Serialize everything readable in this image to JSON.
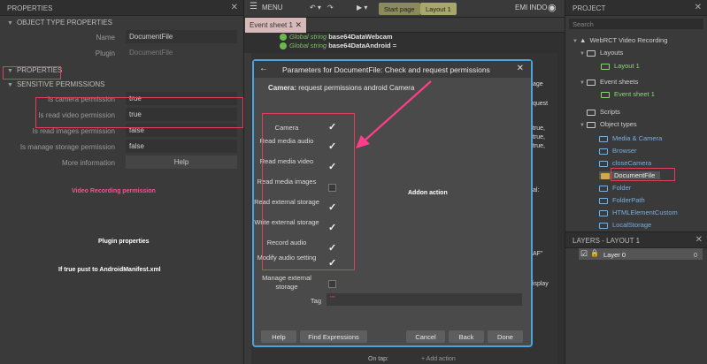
{
  "left": {
    "header": "PROPERTIES",
    "sections": {
      "object_type": "OBJECT TYPE PROPERTIES",
      "properties": "PROPERTIES",
      "sensitive": "SENSITIVE PERMISSIONS"
    },
    "name_label": "Name",
    "name_value": "DocumentFile",
    "plugin_label": "Plugin",
    "plugin_value": "DocumentFile",
    "perm_rows": [
      {
        "label": "Is camera permission",
        "value": "true"
      },
      {
        "label": "Is read video permission",
        "value": "true"
      },
      {
        "label": "Is read images permission",
        "value": "false"
      },
      {
        "label": "Is manage storage permission",
        "value": "false"
      }
    ],
    "more_info_label": "More information",
    "help_label": "Help",
    "notes": {
      "video": "Video Recording permission",
      "plugin": "Plugin properties",
      "manifest": "If true  pust to AndroidManifest.xml"
    }
  },
  "toolbar": {
    "menu_label": "MENU",
    "start_page": "Start page",
    "layout1": "Layout 1",
    "user": "EMI INDO"
  },
  "tab": {
    "label": "Event sheet 1"
  },
  "events": {
    "line1_prefix": "Global string",
    "line1_name": "base64DataWebcam",
    "line2_prefix": "Global string",
    "line2_name": "base64DataAndroid ="
  },
  "ghost": {
    "ontap": "On tap:",
    "addaction": "+ Add action",
    "true1": "true,",
    "true2": "true,",
    "true3": "true,",
    "al": "al:",
    "display": "display",
    "quest": "quest",
    "age": "age",
    "af": "AF\""
  },
  "dialog": {
    "title": "Parameters for DocumentFile: Check and request permissions",
    "desc_bold": "Camera:",
    "desc_rest": "request permissions android Camera",
    "annotation": "Addon action",
    "params": [
      {
        "label": "Camera",
        "checked": true
      },
      {
        "label": "Read media audio",
        "checked": true
      },
      {
        "label": "Read media video",
        "checked": true
      },
      {
        "label": "Read media images",
        "checked": false
      },
      {
        "label": "Read external storage",
        "checked": true
      },
      {
        "label": "Write external storage",
        "checked": true
      },
      {
        "label": "Record audio",
        "checked": true
      },
      {
        "label": "Modify audio setting",
        "checked": true
      },
      {
        "label": "Manage external storage",
        "checked": false
      }
    ],
    "tag_label": "Tag",
    "tag_value": "\"\"",
    "buttons": {
      "help": "Help",
      "find": "Find Expressions",
      "cancel": "Cancel",
      "back": "Back",
      "done": "Done"
    }
  },
  "project": {
    "header": "PROJECT",
    "search_placeholder": "Search",
    "root": "WebRCT Video Recording",
    "layouts": "Layouts",
    "layout1": "Layout 1",
    "event_sheets": "Event sheets",
    "event_sheet1": "Event sheet 1",
    "scripts": "Scripts",
    "object_types": "Object types",
    "objects": [
      "Media & Camera",
      "Browser",
      "closeCamera",
      "DocumentFile",
      "Folder",
      "FolderPath",
      "HTMLElementCustom",
      "LocalStorage"
    ]
  },
  "layers": {
    "header": "LAYERS - LAYOUT 1",
    "layer0": "Layer 0",
    "layer0_num": "0"
  },
  "colors": {
    "accent_blue": "#4aa4e0",
    "annotation_red": "#e0405a",
    "arrow_pink": "#ff3d8a"
  }
}
